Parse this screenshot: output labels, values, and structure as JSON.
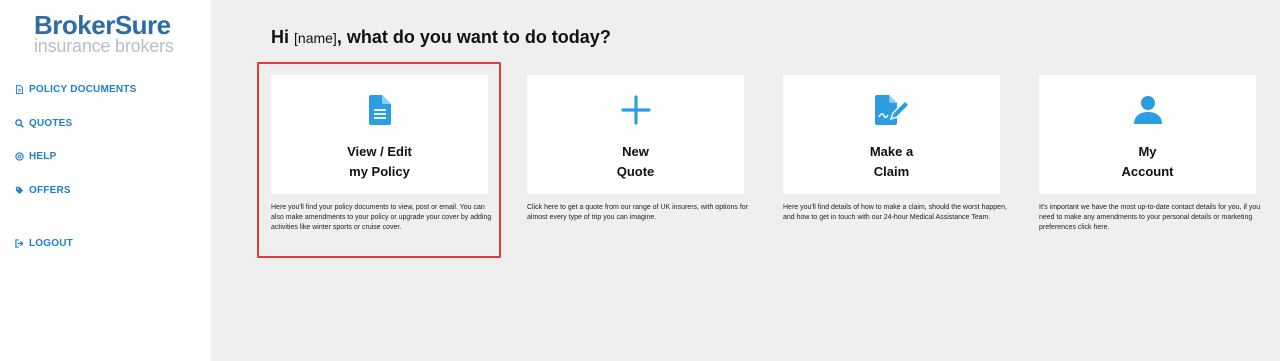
{
  "brand": {
    "word1": "Broker",
    "word2": "Sure",
    "tagline": "insurance brokers"
  },
  "sidebar": {
    "items": [
      {
        "label": "POLICY DOCUMENTS",
        "icon": "document-icon"
      },
      {
        "label": "QUOTES",
        "icon": "search-icon"
      },
      {
        "label": "HELP",
        "icon": "help-circle-icon"
      },
      {
        "label": "OFFERS",
        "icon": "tags-icon"
      },
      {
        "label": "LOGOUT",
        "icon": "sign-out-icon"
      }
    ]
  },
  "main": {
    "greeting_prefix": "Hi",
    "name_placeholder": "[name]",
    "greeting_suffix": ", what do you want to do today?",
    "cards": [
      {
        "title1": "View / Edit",
        "title2": "my Policy",
        "icon": "document-icon",
        "desc": "Here you'll find your policy documents to view, post or email. You can also make amendments to your policy or upgrade your cover by adding activities like winter sports or cruise cover."
      },
      {
        "title1": "New",
        "title2": "Quote",
        "icon": "plus-icon",
        "desc": "Click here to get a quote from our range of UK insurers, with options for almost every type of trip you can imagine."
      },
      {
        "title1": "Make a",
        "title2": "Claim",
        "icon": "signature-icon",
        "desc": "Here you'll find details of how to make a claim, should the worst happen, and how to get in touch with our 24-hour Medical Assistance Team."
      },
      {
        "title1": "My",
        "title2": "Account",
        "icon": "user-icon",
        "desc": "It's important we have the most up-to-date contact details for you, if you need to make any amendments to your personal details or marketing preferences click here."
      }
    ]
  },
  "colors": {
    "accent": "#2b9de0",
    "nav": "#1f7fc9",
    "highlight": "#e03b3b",
    "background": "#efefef"
  }
}
